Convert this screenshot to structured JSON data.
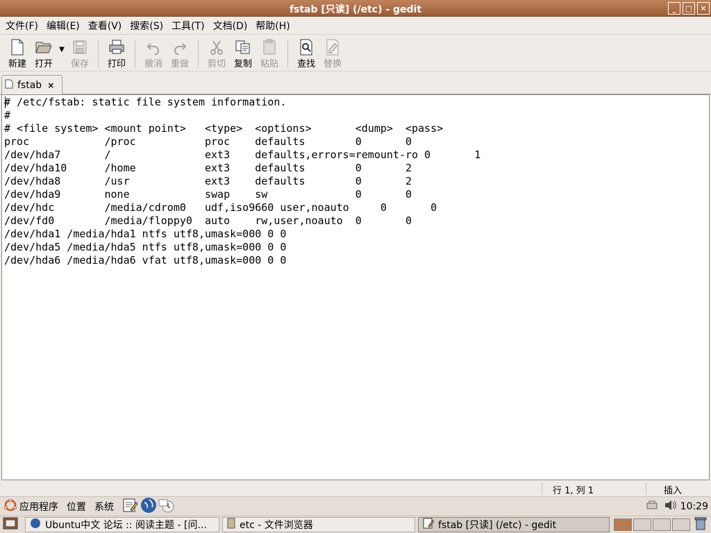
{
  "window": {
    "title": "fstab [只读] (/etc) - gedit",
    "buttons": [
      "_",
      "□",
      "✕"
    ]
  },
  "menubar": {
    "items": [
      "文件(F)",
      "编辑(E)",
      "查看(V)",
      "搜索(S)",
      "工具(T)",
      "文档(D)",
      "帮助(H)"
    ]
  },
  "toolbar": {
    "new_label": "新建",
    "open_label": "打开",
    "save_label": "保存",
    "print_label": "打印",
    "undo_label": "撤消",
    "redo_label": "重做",
    "cut_label": "剪切",
    "copy_label": "复制",
    "paste_label": "粘贴",
    "find_label": "查找",
    "replace_label": "替换"
  },
  "tab": {
    "label": "fstab",
    "close": "×"
  },
  "editor": {
    "lines": [
      "# /etc/fstab: static file system information.",
      "#",
      "# <file system> <mount point>   <type>  <options>       <dump>  <pass>",
      "proc            /proc           proc    defaults        0       0",
      "/dev/hda7       /               ext3    defaults,errors=remount-ro 0       1",
      "/dev/hda10      /home           ext3    defaults        0       2",
      "/dev/hda8       /usr            ext3    defaults        0       2",
      "/dev/hda9       none            swap    sw              0       0",
      "/dev/hdc        /media/cdrom0   udf,iso9660 user,noauto     0       0",
      "/dev/fd0        /media/floppy0  auto    rw,user,noauto  0       0",
      "/dev/hda1 /media/hda1 ntfs utf8,umask=000 0 0",
      "/dev/hda5 /media/hda5 ntfs utf8,umask=000 0 0",
      "/dev/hda6 /media/hda6 vfat utf8,umask=000 0 0"
    ]
  },
  "statusbar": {
    "position": "行 1, 列 1",
    "mode": "插入"
  },
  "panel": {
    "apps": "应用程序",
    "places": "位置",
    "system": "系统",
    "clock": "10:29"
  },
  "taskbar": {
    "tasks": [
      "Ubuntu中文 论坛 :: 阅读主题 - [问...",
      "etc - 文件浏览器",
      "fstab [只读] (/etc) - gedit"
    ]
  },
  "colors": {
    "titlebar": "#9c5d37",
    "workspace_active": "#b97a52"
  }
}
